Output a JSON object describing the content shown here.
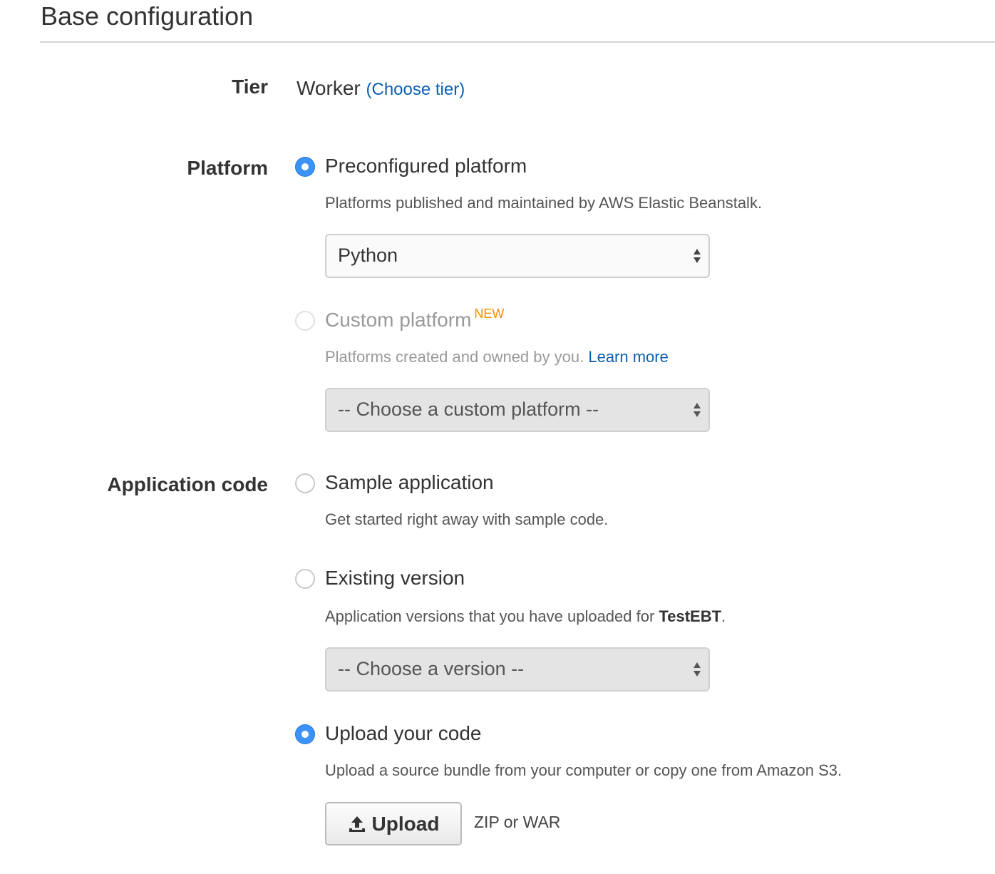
{
  "section": {
    "title": "Base configuration"
  },
  "tier": {
    "label": "Tier",
    "value": "Worker",
    "choose_link": "(Choose tier)"
  },
  "platform": {
    "label": "Platform",
    "preconfigured": {
      "label": "Preconfigured platform",
      "help": "Platforms published and maintained by AWS Elastic Beanstalk.",
      "selected_value": "Python",
      "checked": true
    },
    "custom": {
      "label": "Custom platform",
      "badge": "NEW",
      "help": "Platforms created and owned by you.",
      "learn_more": "Learn more",
      "selected_value": "-- Choose a custom platform --",
      "disabled": true
    }
  },
  "application_code": {
    "label": "Application code",
    "sample": {
      "label": "Sample application",
      "help": "Get started right away with sample code."
    },
    "existing": {
      "label": "Existing version",
      "help_prefix": "Application versions that you have uploaded for ",
      "app_name": "TestEBT",
      "help_suffix": ".",
      "selected_value": "-- Choose a version --"
    },
    "upload": {
      "label": "Upload your code",
      "help": "Upload a source bundle from your computer or copy one from Amazon S3.",
      "button_label": "Upload",
      "button_icon": "upload-icon",
      "formats": "ZIP or WAR",
      "checked": true
    }
  },
  "colors": {
    "link": "#0b5fb3",
    "radio_checked": "#3c93f5",
    "badge_new": "#ff8a00"
  }
}
